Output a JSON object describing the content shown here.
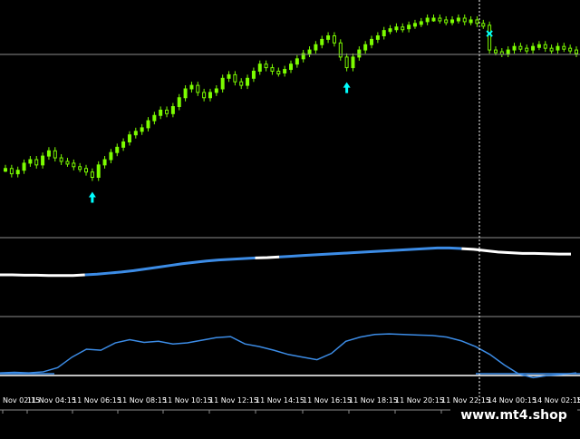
{
  "time_axis": {
    "labels": [
      "Nov 02:15",
      "11 Nov 04:15",
      "11 Nov 06:15",
      "11 Nov 08:15",
      "11 Nov 10:15",
      "11 Nov 12:15",
      "11 Nov 14:15",
      "11 Nov 16:15",
      "11 Nov 18:15",
      "11 Nov 20:15",
      "11 Nov 22:15",
      "14 Nov 00:15",
      "14 Nov 02:15",
      "1"
    ]
  },
  "watermark": {
    "text": "www.mt4.shop"
  },
  "colors": {
    "background": "#000000",
    "bull_candle": "#7CFC00",
    "wick": "#7CFC00",
    "signal_arrow": "#00FFFF",
    "indicator_blue": "#3C8CE6",
    "indicator_white": "#FFFFFF",
    "separator": "#8C8C8C",
    "crosshair": "#FFFFFF"
  },
  "signals": [
    {
      "type": "buy",
      "icon": "up-arrow-icon"
    },
    {
      "type": "buy",
      "icon": "up-arrow-icon"
    },
    {
      "type": "close",
      "icon": "x-mark-icon"
    }
  ],
  "price_series": [
    0.15,
    0.12,
    0.14,
    0.18,
    0.2,
    0.17,
    0.22,
    0.25,
    0.21,
    0.19,
    0.18,
    0.16,
    0.15,
    0.13,
    0.1,
    0.17,
    0.2,
    0.24,
    0.27,
    0.3,
    0.34,
    0.36,
    0.38,
    0.42,
    0.45,
    0.48,
    0.46,
    0.5,
    0.55,
    0.6,
    0.62,
    0.58,
    0.55,
    0.58,
    0.6,
    0.66,
    0.68,
    0.64,
    0.62,
    0.66,
    0.7,
    0.74,
    0.72,
    0.7,
    0.69,
    0.71,
    0.74,
    0.77,
    0.8,
    0.82,
    0.85,
    0.88,
    0.9,
    0.86,
    0.78,
    0.72,
    0.78,
    0.82,
    0.85,
    0.88,
    0.9,
    0.93,
    0.94,
    0.95,
    0.94,
    0.96,
    0.97,
    0.98,
    1.0,
    1.0,
    0.99,
    0.98,
    0.99,
    1.0,
    0.98,
    0.99,
    0.97,
    0.96,
    0.82,
    0.81,
    0.8,
    0.82,
    0.84,
    0.83,
    0.82,
    0.84,
    0.85,
    0.83,
    0.82,
    0.84,
    0.83,
    0.82,
    0.8
  ],
  "ma_series": [
    0.08,
    0.08,
    0.07,
    0.07,
    0.06,
    0.06,
    0.06,
    0.08,
    0.1,
    0.13,
    0.16,
    0.2,
    0.25,
    0.3,
    0.35,
    0.4,
    0.44,
    0.48,
    0.51,
    0.53,
    0.55,
    0.57,
    0.58,
    0.6,
    0.62,
    0.64,
    0.66,
    0.68,
    0.7,
    0.72,
    0.74,
    0.76,
    0.78,
    0.8,
    0.82,
    0.84,
    0.86,
    0.86,
    0.84,
    0.82,
    0.78,
    0.74,
    0.72,
    0.7,
    0.7,
    0.69,
    0.68,
    0.68
  ],
  "osc_series": [
    0.05,
    0.06,
    0.05,
    0.07,
    0.15,
    0.35,
    0.5,
    0.48,
    0.62,
    0.68,
    0.63,
    0.65,
    0.6,
    0.62,
    0.67,
    0.72,
    0.74,
    0.6,
    0.55,
    0.48,
    0.4,
    0.35,
    0.3,
    0.42,
    0.65,
    0.73,
    0.78,
    0.79,
    0.78,
    0.77,
    0.76,
    0.73,
    0.66,
    0.55,
    0.4,
    0.2,
    0.03,
    -0.04,
    0.0,
    0.02,
    0.05
  ]
}
